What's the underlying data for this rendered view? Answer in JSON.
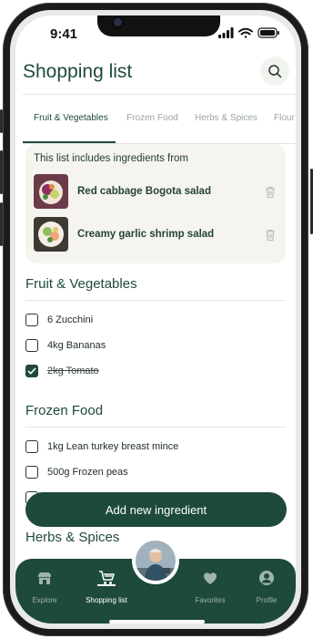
{
  "status_bar": {
    "time": "9:41"
  },
  "header": {
    "title": "Shopping list",
    "search_icon": "search-icon"
  },
  "category_tabs": [
    "Fruit & Vegetables",
    "Frozen Food",
    "Herbs & Spices",
    "Flour"
  ],
  "active_tab": "Fruit & Vegetables",
  "recipes": {
    "heading": "This list includes ingredients from",
    "items": [
      {
        "name": "Red cabbage Bogota salad",
        "icon": "trash-icon"
      },
      {
        "name": "Creamy garlic shrimp salad",
        "icon": "trash-icon"
      }
    ]
  },
  "sections": [
    {
      "title": "Fruit & Vegetables",
      "items": [
        {
          "label": "6 Zucchini",
          "checked": false
        },
        {
          "label": "4kg Bananas",
          "checked": false
        },
        {
          "label": "2kg Tomato",
          "checked": true
        }
      ]
    },
    {
      "title": "Frozen Food",
      "items": [
        {
          "label": "1kg Lean turkey breast mince",
          "checked": false
        },
        {
          "label": "500g Frozen peas",
          "checked": false
        }
      ]
    },
    {
      "title": "Herbs & Spices",
      "items": []
    }
  ],
  "add_button": {
    "label": "Add new ingredient"
  },
  "bottom_nav": {
    "items": [
      {
        "label": "Explore",
        "icon": "store-icon"
      },
      {
        "label": "Shopping list",
        "icon": "cart-icon"
      },
      {
        "label": "Favorites",
        "icon": "heart-icon"
      },
      {
        "label": "Profile",
        "icon": "profile-icon"
      }
    ],
    "active": "Shopping list"
  },
  "colors": {
    "primary": "#1d4a3b",
    "card_background": "#f5f4ef",
    "muted_text": "#9aa69f"
  }
}
